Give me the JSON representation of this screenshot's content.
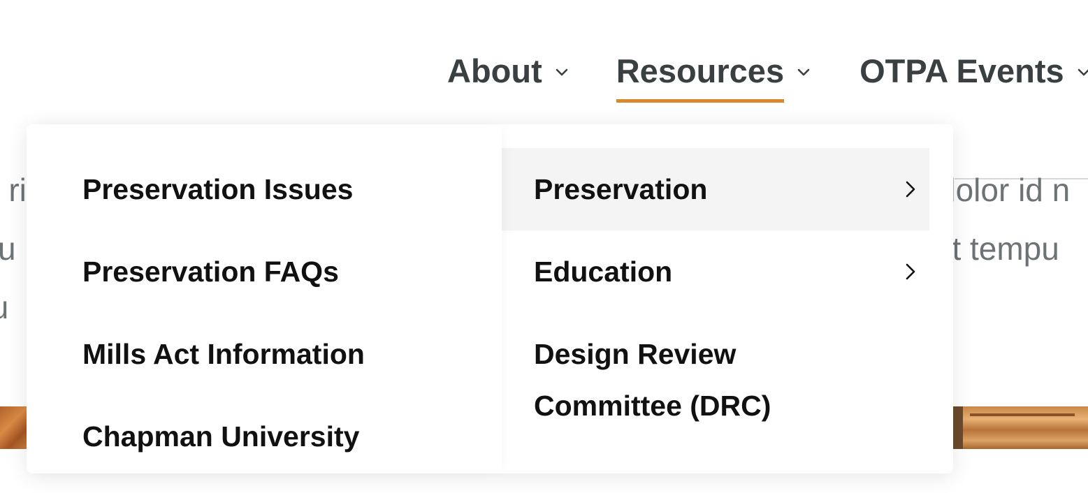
{
  "nav": {
    "items": [
      {
        "label": "About"
      },
      {
        "label": "Resources"
      },
      {
        "label": "OTPA Events"
      }
    ],
    "active_index": 1,
    "accent_color": "#d9892c",
    "text_color": "#3a4042"
  },
  "background": {
    "left_lines": [
      "o ri",
      "su",
      "tu"
    ],
    "right_lines": [
      "dolor id n",
      "lit tempu"
    ]
  },
  "dropdown": {
    "main_items": [
      {
        "label": "Preservation",
        "has_submenu": true,
        "active": true
      },
      {
        "label": "Education",
        "has_submenu": true,
        "active": false
      },
      {
        "label": "Design Review Committee (DRC)",
        "has_submenu": false,
        "active": false
      }
    ],
    "submenu_items": [
      {
        "label": "Preservation Issues"
      },
      {
        "label": "Preservation FAQs"
      },
      {
        "label": "Mills Act Information"
      },
      {
        "label": "Chapman University"
      }
    ]
  }
}
